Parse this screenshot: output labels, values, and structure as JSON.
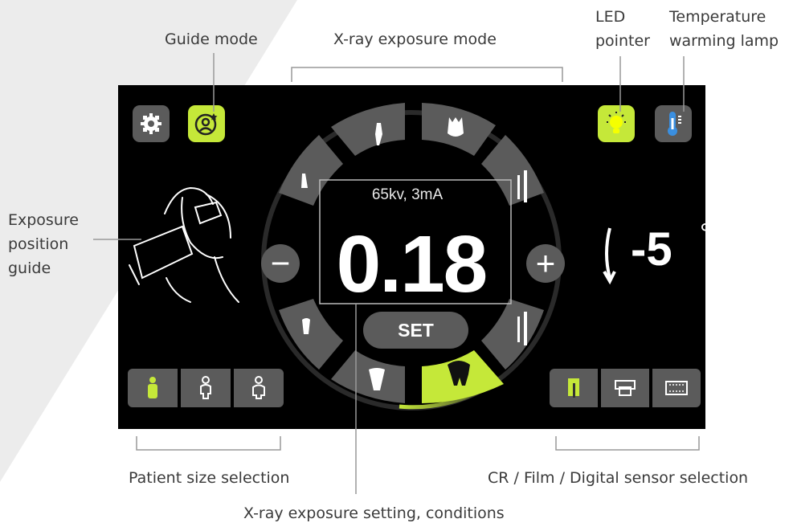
{
  "callouts": {
    "guide_mode": "Guide mode",
    "xray_exposure_mode": "X-ray exposure mode",
    "led_pointer_line1": "LED",
    "led_pointer_line2": "pointer",
    "temp_lamp_line1": "Temperature",
    "temp_lamp_line2": "warming lamp",
    "exposure_guide_line1": "Exposure",
    "exposure_guide_line2": "position",
    "exposure_guide_line3": "guide",
    "patient_size": "Patient size selection",
    "sensor_selection": "CR / Film / Digital sensor selection",
    "exposure_setting": "X-ray exposure setting, conditions"
  },
  "screen": {
    "conditions": "65kv, 3mA",
    "exposure_value": "0.18",
    "set_label": "SET",
    "minus_label": "−",
    "plus_label": "+",
    "angle_value": "-5",
    "angle_unit": "°",
    "selected_tooth_segment": "lower-molar",
    "selected_patient_size": "child",
    "selected_sensor": "cr"
  },
  "colors": {
    "accent": "#c5e839",
    "button": "#5b5b5b",
    "screen_bg": "#000000",
    "thermometer": "#3a8fe0"
  },
  "icons": {
    "settings": "gear-icon",
    "guide": "user-star-icon",
    "led": "lightbulb-icon",
    "temperature": "thermometer-icon",
    "rotation": "rotate-arrows-icon"
  }
}
